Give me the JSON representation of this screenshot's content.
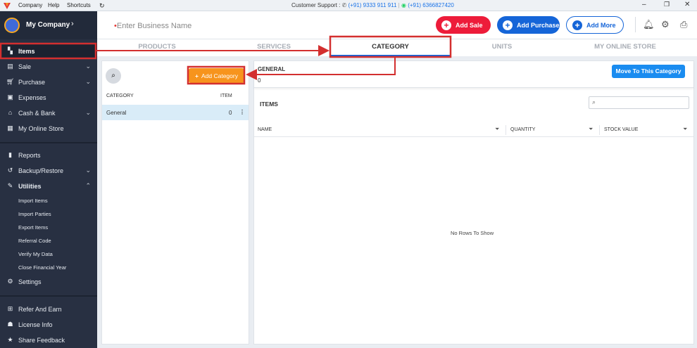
{
  "titlebar": {
    "menu": [
      "Company",
      "Help",
      "Shortcuts"
    ],
    "refresh_icon": "refresh-icon",
    "support_label": "Customer Support :",
    "phone": "(+91) 9333 911 911",
    "whatsapp": "(+91) 6366827420"
  },
  "sidebar": {
    "company_name": "My Company",
    "items": [
      {
        "label": "Items",
        "icon": "items-icon"
      },
      {
        "label": "Sale",
        "icon": "sale-icon"
      },
      {
        "label": "Purchase",
        "icon": "cart-icon"
      },
      {
        "label": "Expenses",
        "icon": "expenses-icon"
      },
      {
        "label": "Cash & Bank",
        "icon": "bank-icon"
      },
      {
        "label": "My Online Store",
        "icon": "store-icon"
      },
      {
        "label": "Reports",
        "icon": "chart-icon"
      },
      {
        "label": "Backup/Restore",
        "icon": "backup-icon"
      },
      {
        "label": "Utilities",
        "icon": "wrench-icon"
      }
    ],
    "utilities_sub": [
      "Import Items",
      "Import Parties",
      "Export Items",
      "Referral Code",
      "Verify My Data",
      "Close Financial Year"
    ],
    "bottom": [
      {
        "label": "Settings",
        "icon": "gear-icon"
      },
      {
        "label": "Refer And Earn",
        "icon": "gift-icon"
      },
      {
        "label": "License Info",
        "icon": "license-icon"
      },
      {
        "label": "Share Feedback",
        "icon": "star-icon"
      }
    ]
  },
  "topbar": {
    "business_placeholder": "Enter Business Name",
    "add_sale": "Add Sale",
    "add_purchase": "Add Purchase",
    "add_more": "Add More"
  },
  "tabs": [
    "PRODUCTS",
    "SERVICES",
    "CATEGORY",
    "UNITS",
    "MY ONLINE STORE"
  ],
  "category_panel": {
    "add_button": "Add Category",
    "col_category": "CATEGORY",
    "col_item": "ITEM",
    "rows": [
      {
        "name": "General",
        "count": "0"
      }
    ]
  },
  "detail_panel": {
    "category_name": "GENERAL",
    "category_count": "0",
    "move_button": "Move To This Category",
    "items_title": "ITEMS",
    "columns": [
      "NAME",
      "QUANTITY",
      "STOCK VALUE"
    ],
    "empty_message": "No Rows To Show"
  },
  "colors": {
    "sidebar_bg": "#283042",
    "accent_blue": "#1565d8",
    "sale_red": "#ed1c3a",
    "add_category_orange": "#f7941d",
    "highlight_red": "#d32f2f"
  }
}
